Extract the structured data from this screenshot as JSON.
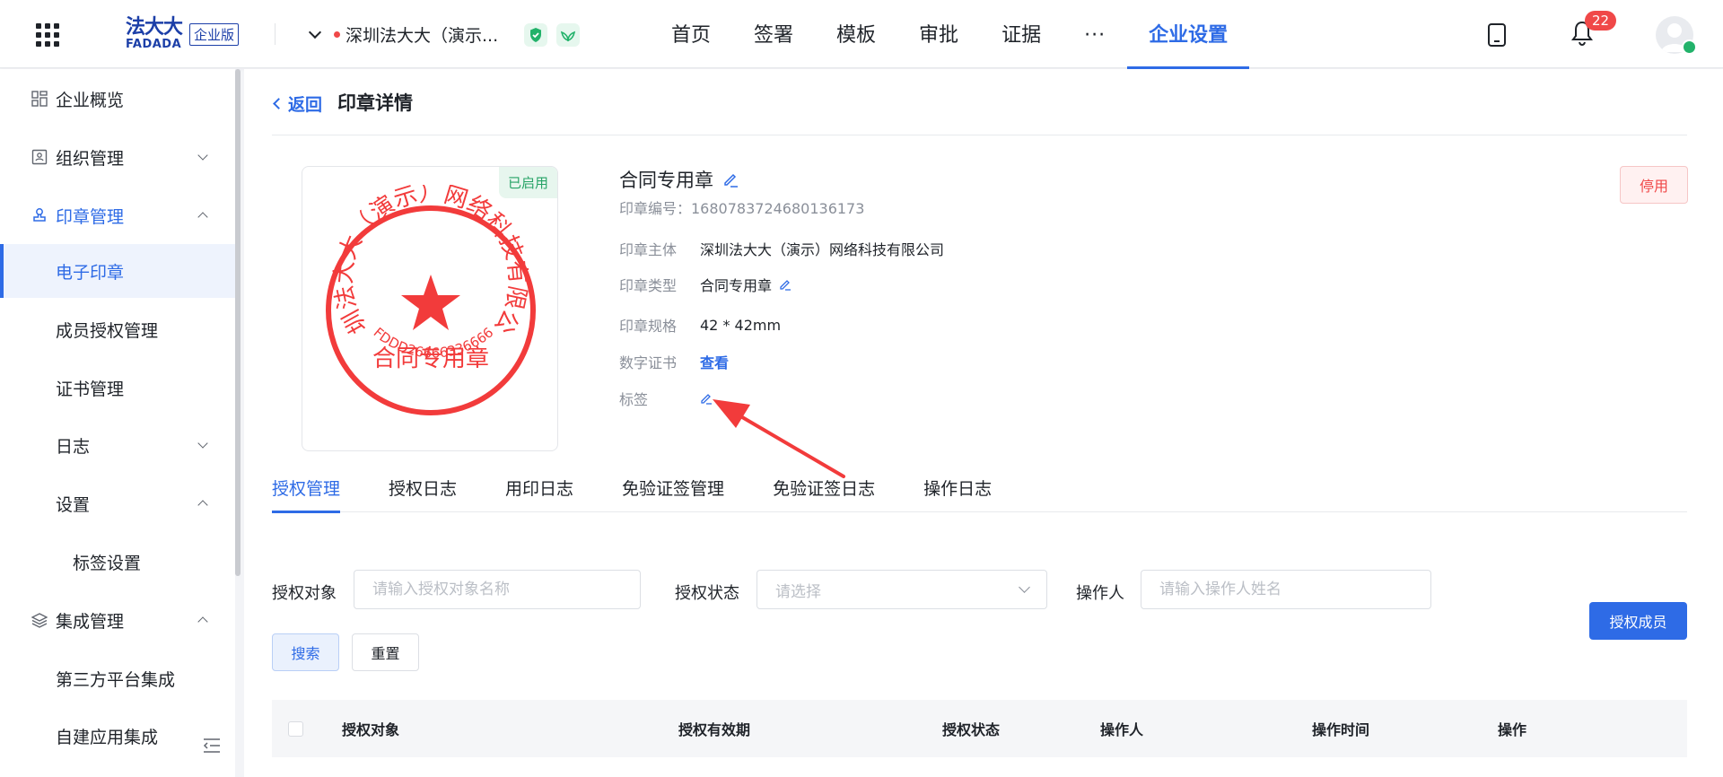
{
  "header": {
    "logo_cn": "法大大",
    "logo_en": "FADADA",
    "edition": "企业版",
    "org_name": "深圳法大大（演示...",
    "nav": [
      "首页",
      "签署",
      "模板",
      "审批",
      "证据"
    ],
    "nav_more": "···",
    "nav_active": "企业设置",
    "notification_count": "22"
  },
  "sidebar": {
    "items": [
      {
        "label": "企业概览"
      },
      {
        "label": "组织管理"
      },
      {
        "label": "印章管理"
      },
      {
        "label": "电子印章"
      },
      {
        "label": "成员授权管理"
      },
      {
        "label": "证书管理"
      },
      {
        "label": "日志"
      },
      {
        "label": "设置"
      },
      {
        "label": "标签设置"
      },
      {
        "label": "集成管理"
      },
      {
        "label": "第三方平台集成"
      },
      {
        "label": "自建应用集成"
      }
    ]
  },
  "page": {
    "back_label": "返回",
    "title": "印章详情"
  },
  "seal": {
    "status": "已启用",
    "company_text": "深圳法大大（演示）网络科技有限公司",
    "type_text": "合同专用章",
    "code_text": "FDDD26666336666",
    "color": "#f23b3b"
  },
  "detail": {
    "name": "合同专用章",
    "seal_no": "印章编号：1680783724680136173",
    "rows": [
      {
        "k": "印章主体",
        "v": "深圳法大大（演示）网络科技有限公司"
      },
      {
        "k": "印章类型",
        "v": "合同专用章"
      },
      {
        "k": "印章规格",
        "v": "42 * 42mm"
      },
      {
        "k": "数字证书",
        "v": "查看"
      },
      {
        "k": "标签",
        "v": ""
      }
    ],
    "disable_label": "停用"
  },
  "tabs": [
    "授权管理",
    "授权日志",
    "用印日志",
    "免验证签管理",
    "免验证签日志",
    "操作日志"
  ],
  "filters": {
    "target_label": "授权对象",
    "target_placeholder": "请输入授权对象名称",
    "status_label": "授权状态",
    "status_placeholder": "请选择",
    "operator_label": "操作人",
    "operator_placeholder": "请输入操作人姓名",
    "search_label": "搜索",
    "reset_label": "重置",
    "grant_label": "授权成员"
  },
  "table": {
    "columns": [
      "授权对象",
      "授权有效期",
      "授权状态",
      "操作人",
      "操作时间",
      "操作"
    ]
  },
  "colors": {
    "accent": "#2e6be6",
    "danger": "#f04848",
    "success": "#26a366"
  }
}
